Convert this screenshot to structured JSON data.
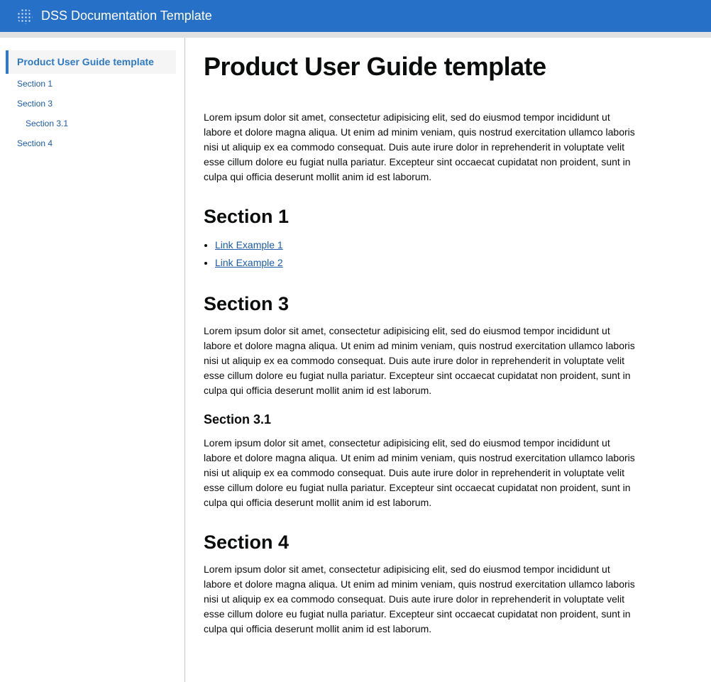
{
  "header": {
    "title": "DSS Documentation Template",
    "logo_icon": "snowflake-dots-icon"
  },
  "sidebar": {
    "items": [
      {
        "label": "Product User Guide template",
        "active": true
      },
      {
        "label": "Section 1"
      },
      {
        "label": "Section 3"
      },
      {
        "label": "Section 3.1"
      },
      {
        "label": "Section 4"
      }
    ]
  },
  "main": {
    "title": "Product User Guide template",
    "intro": "Lorem ipsum dolor sit amet, consectetur adipisicing elit, sed do eiusmod tempor incididunt ut labore et dolore magna aliqua. Ut enim ad minim veniam, quis nostrud exercitation ullamco laboris nisi ut aliquip ex ea commodo consequat. Duis aute irure dolor in reprehenderit in voluptate velit esse cillum dolore eu fugiat nulla pariatur. Excepteur sint occaecat cupidatat non proident, sunt in culpa qui officia deserunt mollit anim id est laborum.",
    "section1": {
      "heading": "Section 1",
      "links": [
        "Link Example 1",
        "Link Example 2"
      ]
    },
    "section3": {
      "heading": "Section 3",
      "text": "Lorem ipsum dolor sit amet, consectetur adipisicing elit, sed do eiusmod tempor incididunt ut labore et dolore magna aliqua. Ut enim ad minim veniam, quis nostrud exercitation ullamco laboris nisi ut aliquip ex ea commodo consequat. Duis aute irure dolor in reprehenderit in voluptate velit esse cillum dolore eu fugiat nulla pariatur. Excepteur sint occaecat cupidatat non proident, sunt in culpa qui officia deserunt mollit anim id est laborum."
    },
    "section31": {
      "heading": "Section 3.1",
      "text": "Lorem ipsum dolor sit amet, consectetur adipisicing elit, sed do eiusmod tempor incididunt ut labore et dolore magna aliqua. Ut enim ad minim veniam, quis nostrud exercitation ullamco laboris nisi ut aliquip ex ea commodo consequat. Duis aute irure dolor in reprehenderit in voluptate velit esse cillum dolore eu fugiat nulla pariatur. Excepteur sint occaecat cupidatat non proident, sunt in culpa qui officia deserunt mollit anim id est laborum."
    },
    "section4": {
      "heading": "Section 4",
      "text": "Lorem ipsum dolor sit amet, consectetur adipisicing elit, sed do eiusmod tempor incididunt ut labore et dolore magna aliqua. Ut enim ad minim veniam, quis nostrud exercitation ullamco laboris nisi ut aliquip ex ea commodo consequat. Duis aute irure dolor in reprehenderit in voluptate velit esse cillum dolore eu fugiat nulla pariatur. Excepteur sint occaecat cupidatat non proident, sunt in culpa qui officia deserunt mollit anim id est laborum."
    }
  }
}
